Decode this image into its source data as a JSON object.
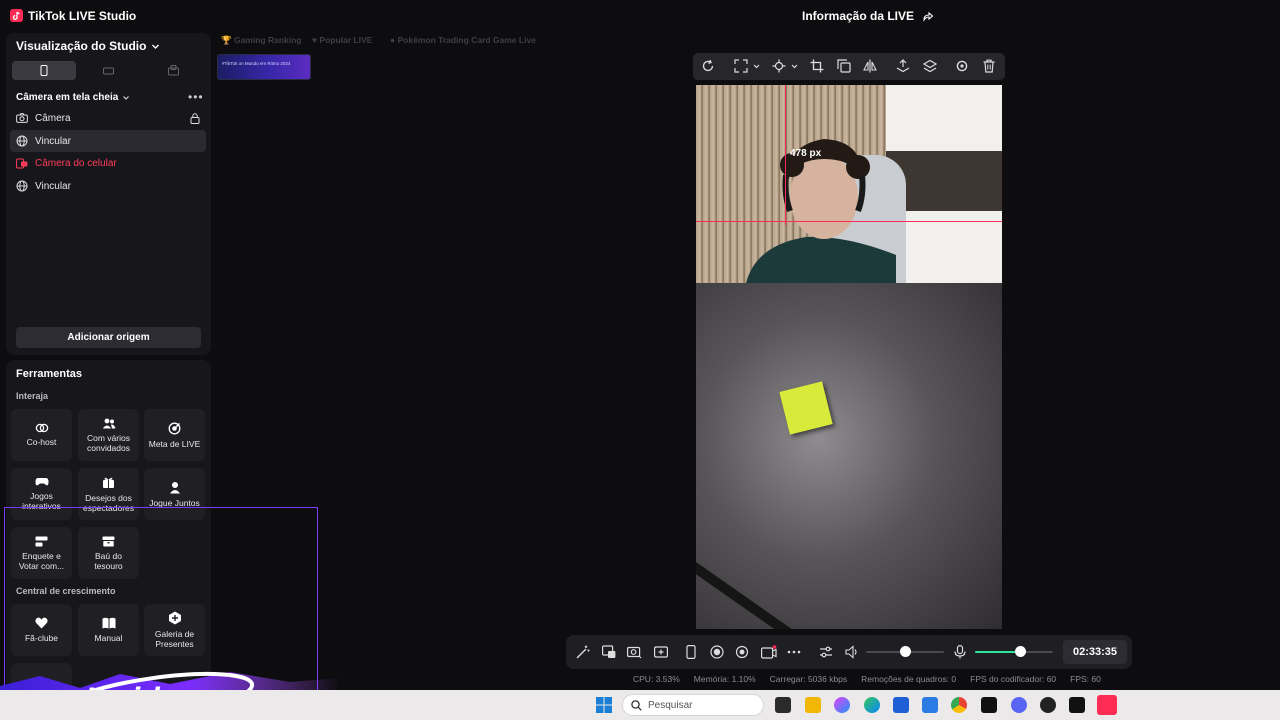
{
  "app": {
    "title": "TikTok LIVE Studio",
    "live_info": "Informação da LIVE"
  },
  "studio": {
    "title": "Visualização do Studio",
    "scene_title": "Câmera em tela cheia",
    "sources": [
      {
        "label": "Câmera",
        "icon": "camera-icon"
      },
      {
        "label": "Vincular",
        "icon": "globe-icon"
      },
      {
        "label": "Câmera do celular",
        "icon": "phone-camera-icon"
      },
      {
        "label": "Vincular",
        "icon": "globe-icon"
      }
    ],
    "add_source": "Adicionar origem"
  },
  "tools": {
    "title": "Ferramentas",
    "interact_label": "Interaja",
    "growth_label": "Central de crescimento",
    "interact": [
      {
        "label": "Co-host",
        "icon": "link-icon"
      },
      {
        "label": "Com vários convidados",
        "icon": "users-icon"
      },
      {
        "label": "Meta de LIVE",
        "icon": "target-icon"
      },
      {
        "label": "Jogos interativos",
        "icon": "gamepad-icon"
      },
      {
        "label": "Desejos dos espectadores",
        "icon": "gift-icon"
      },
      {
        "label": "Jogue Juntos",
        "icon": "user-icon"
      },
      {
        "label": "Enquete e Votar com...",
        "icon": "poll-icon"
      },
      {
        "label": "Baú do tesouro",
        "icon": "chest-icon"
      }
    ],
    "growth": [
      {
        "label": "Fã-clube",
        "icon": "heart-icon"
      },
      {
        "label": "Manual",
        "icon": "book-icon"
      },
      {
        "label": "Galeria de Presentes",
        "icon": "gallery-icon"
      }
    ]
  },
  "rankings": [
    "Gaming Ranking",
    "Popular LIVE",
    "Pokémon Trading Card Game Live"
  ],
  "thumbnail_text": "#TikTok on Mundo em Ritmo 2024",
  "preview": {
    "guide_label": "478 px"
  },
  "status": {
    "timer": "02:33:35",
    "volume_level": 0.5,
    "mic_level": 0.58,
    "cpu": "CPU: 3.53%",
    "memory": "Memória: 1.10%",
    "upload": "Carregar: 5036 kbps",
    "dropped_frames": "Remoções de quadros: 0",
    "encoder_fps": "FPS do codificador: 60",
    "fps": "FPS: 60"
  },
  "taskbar": {
    "search_placeholder": "Pesquisar"
  },
  "overlay": {
    "brand": "Insider"
  },
  "colors": {
    "accent": "#fe2c55",
    "mic_level": "#2ee59d",
    "promo_frame": "#7b3cff"
  }
}
